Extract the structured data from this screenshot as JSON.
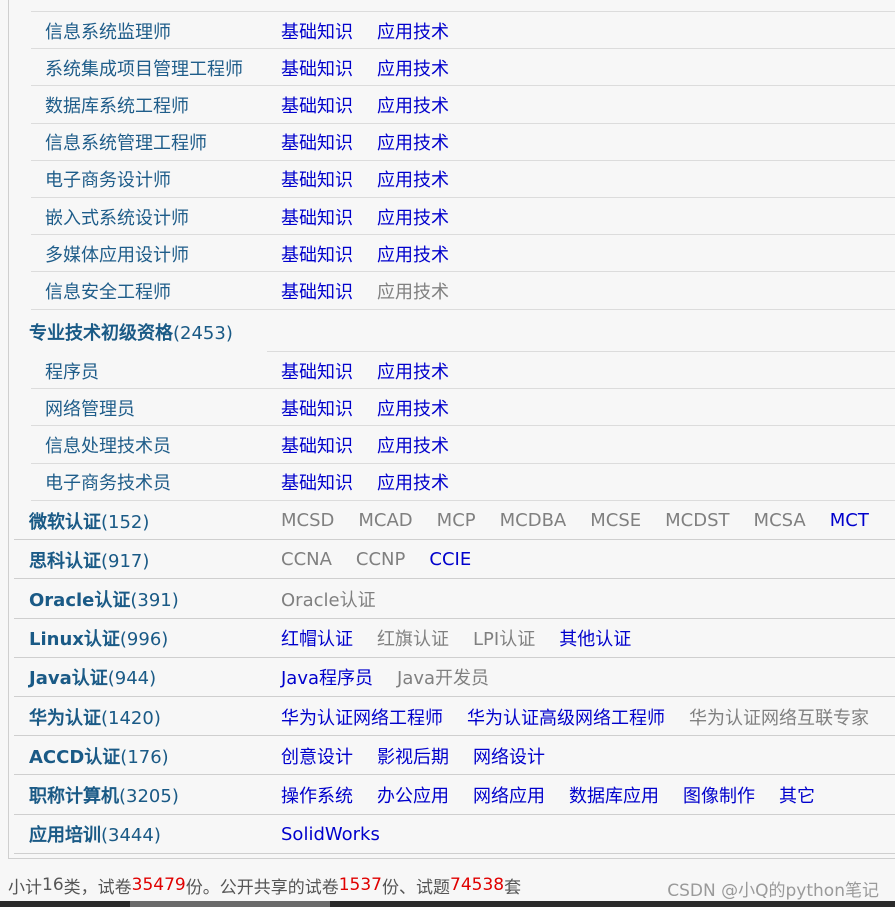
{
  "sub_rows_top": [
    {
      "label": "信息系统监理师",
      "links": [
        {
          "text": "基础知识",
          "active": true
        },
        {
          "text": "应用技术",
          "active": true
        }
      ]
    },
    {
      "label": "系统集成项目管理工程师",
      "links": [
        {
          "text": "基础知识",
          "active": true
        },
        {
          "text": "应用技术",
          "active": true
        }
      ]
    },
    {
      "label": "数据库系统工程师",
      "links": [
        {
          "text": "基础知识",
          "active": true
        },
        {
          "text": "应用技术",
          "active": true
        }
      ]
    },
    {
      "label": "信息系统管理工程师",
      "links": [
        {
          "text": "基础知识",
          "active": true
        },
        {
          "text": "应用技术",
          "active": true
        }
      ]
    },
    {
      "label": "电子商务设计师",
      "links": [
        {
          "text": "基础知识",
          "active": true
        },
        {
          "text": "应用技术",
          "active": true
        }
      ]
    },
    {
      "label": "嵌入式系统设计师",
      "links": [
        {
          "text": "基础知识",
          "active": true
        },
        {
          "text": "应用技术",
          "active": true
        }
      ]
    },
    {
      "label": "多媒体应用设计师",
      "links": [
        {
          "text": "基础知识",
          "active": true
        },
        {
          "text": "应用技术",
          "active": true
        }
      ]
    },
    {
      "label": "信息安全工程师",
      "links": [
        {
          "text": "基础知识",
          "active": true
        },
        {
          "text": "应用技术",
          "active": false
        }
      ]
    }
  ],
  "junior_header": {
    "label": "专业技术初级资格",
    "count": "(2453)"
  },
  "sub_rows_junior": [
    {
      "label": "程序员",
      "links": [
        {
          "text": "基础知识",
          "active": true
        },
        {
          "text": "应用技术",
          "active": true
        }
      ]
    },
    {
      "label": "网络管理员",
      "links": [
        {
          "text": "基础知识",
          "active": true
        },
        {
          "text": "应用技术",
          "active": true
        }
      ]
    },
    {
      "label": "信息处理技术员",
      "links": [
        {
          "text": "基础知识",
          "active": true
        },
        {
          "text": "应用技术",
          "active": true
        }
      ]
    },
    {
      "label": "电子商务技术员",
      "links": [
        {
          "text": "基础知识",
          "active": true
        },
        {
          "text": "应用技术",
          "active": true
        }
      ]
    }
  ],
  "categories": [
    {
      "label": "微软认证",
      "count": "(152)",
      "links": [
        {
          "text": "MCSD",
          "active": false
        },
        {
          "text": "MCAD",
          "active": false
        },
        {
          "text": "MCP",
          "active": false
        },
        {
          "text": "MCDBA",
          "active": false
        },
        {
          "text": "MCSE",
          "active": false
        },
        {
          "text": "MCDST",
          "active": false
        },
        {
          "text": "MCSA",
          "active": false
        },
        {
          "text": "MCT",
          "active": true
        }
      ]
    },
    {
      "label": "思科认证",
      "count": "(917)",
      "links": [
        {
          "text": "CCNA",
          "active": false
        },
        {
          "text": "CCNP",
          "active": false
        },
        {
          "text": "CCIE",
          "active": true
        }
      ]
    },
    {
      "label": "Oracle认证",
      "count": "(391)",
      "links": [
        {
          "text": "Oracle认证",
          "active": false
        }
      ]
    },
    {
      "label": "Linux认证",
      "count": "(996)",
      "links": [
        {
          "text": "红帽认证",
          "active": true
        },
        {
          "text": "红旗认证",
          "active": false
        },
        {
          "text": "LPI认证",
          "active": false
        },
        {
          "text": "其他认证",
          "active": true
        }
      ]
    },
    {
      "label": "Java认证",
      "count": "(944)",
      "links": [
        {
          "text": "Java程序员",
          "active": true
        },
        {
          "text": "Java开发员",
          "active": false
        }
      ]
    },
    {
      "label": "华为认证",
      "count": "(1420)",
      "links": [
        {
          "text": "华为认证网络工程师",
          "active": true
        },
        {
          "text": "华为认证高级网络工程师",
          "active": true
        },
        {
          "text": "华为认证网络互联专家",
          "active": false
        }
      ]
    },
    {
      "label": "ACCD认证",
      "count": "(176)",
      "links": [
        {
          "text": "创意设计",
          "active": true
        },
        {
          "text": "影视后期",
          "active": true
        },
        {
          "text": "网络设计",
          "active": true
        }
      ]
    },
    {
      "label": "职称计算机",
      "count": "(3205)",
      "links": [
        {
          "text": "操作系统",
          "active": true
        },
        {
          "text": "办公应用",
          "active": true
        },
        {
          "text": "网络应用",
          "active": true
        },
        {
          "text": "数据库应用",
          "active": true
        },
        {
          "text": "图像制作",
          "active": true
        },
        {
          "text": "其它",
          "active": true
        }
      ]
    },
    {
      "label": "应用培训",
      "count": "(3444)",
      "links": [
        {
          "text": "SolidWorks",
          "active": true
        }
      ]
    }
  ],
  "footer": {
    "t1": "小计",
    "n1": "16",
    "t2": "类，试卷",
    "n2": "35479",
    "t3": "份。公开共享的试卷",
    "n3": "1537",
    "t4": "份、试题",
    "n4": "74538",
    "t5": "套"
  },
  "watermark": "CSDN @小Q的python笔记",
  "colors": {
    "active_link": "#0000cc",
    "inactive_link": "#808080",
    "category": "#1a5a86",
    "highlight_number": "#e00000"
  }
}
